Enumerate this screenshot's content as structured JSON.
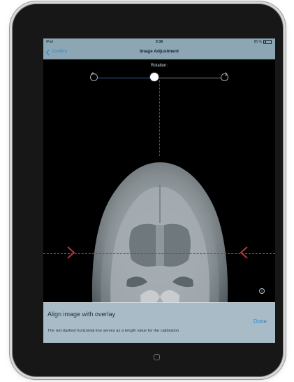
{
  "status_bar": {
    "carrier": "iPad",
    "time": "9:38",
    "battery_text": "85 %"
  },
  "nav_bar": {
    "back_label": "Confirm",
    "title": "Image Adjustment"
  },
  "rotation": {
    "label": "Rotation:",
    "value_fraction": 0.46
  },
  "overlay_panel": {
    "title": "Align image with overlay",
    "description": "The red dashed horizontal line serves as a length value for the calibration",
    "done_label": "Done"
  },
  "info": {
    "symbol": "i"
  },
  "icons": {
    "back": "chevron-left-icon",
    "rotate_ccw": "rotate-counterclockwise-icon",
    "rotate_cw": "rotate-clockwise-icon",
    "left_marker": "calibration-left-marker-icon",
    "right_marker": "calibration-right-marker-icon",
    "info": "info-icon",
    "home": "home-button-icon"
  },
  "colors": {
    "nav_bar": "#8da6b4",
    "link": "#2b86c8",
    "panel": "#a9bbc6",
    "calibration_line": "#a83a3a"
  }
}
